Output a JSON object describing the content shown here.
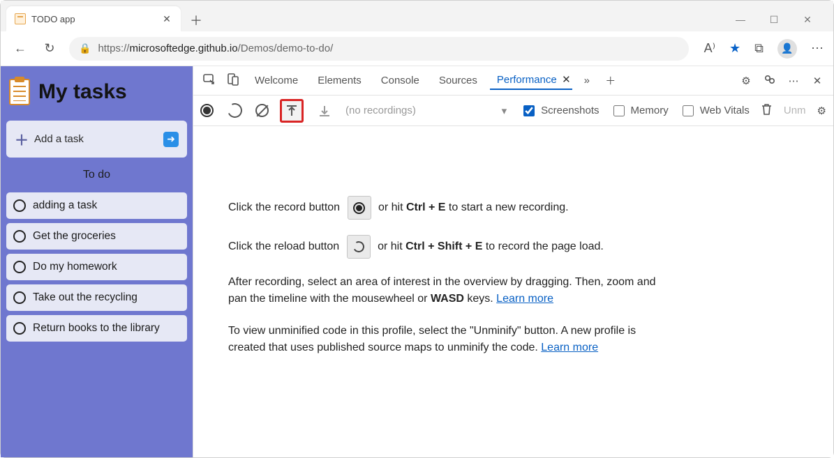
{
  "browser": {
    "tab_title": "TODO app",
    "url_prefix": "https://",
    "url_host": "microsoftedge.github.io",
    "url_path": "/Demos/demo-to-do/"
  },
  "page": {
    "heading": "My tasks",
    "add_task_label": "Add a task",
    "todo_section_label": "To do",
    "tasks": [
      "adding a task",
      "Get the groceries",
      "Do my homework",
      "Take out the recycling",
      "Return books to the library"
    ]
  },
  "devtools": {
    "tabs": {
      "welcome": "Welcome",
      "elements": "Elements",
      "console": "Console",
      "sources": "Sources",
      "performance": "Performance"
    },
    "toolbar": {
      "no_recordings": "(no recordings)",
      "screenshots": "Screenshots",
      "memory": "Memory",
      "web_vitals": "Web Vitals",
      "unminify": "Unm"
    },
    "hints": {
      "rec1": "Click the record button",
      "rec2": "or hit ",
      "rec_shortcut": "Ctrl + E",
      "rec3": " to start a new recording.",
      "rel1": "Click the reload button",
      "rel2": "or hit ",
      "rel_shortcut": "Ctrl + Shift + E",
      "rel3": " to record the page load.",
      "after1": "After recording, select an area of interest in the overview by dragging. Then, zoom and pan the timeline with the mousewheel or ",
      "wasd": "WASD",
      "after2": " keys. ",
      "after_link": "Learn more",
      "unmin1": "To view unminified code in this profile, select the \"Unminify\" button. A new profile is created that uses published source maps to unminify the code. ",
      "unmin_link": "Learn more"
    }
  }
}
